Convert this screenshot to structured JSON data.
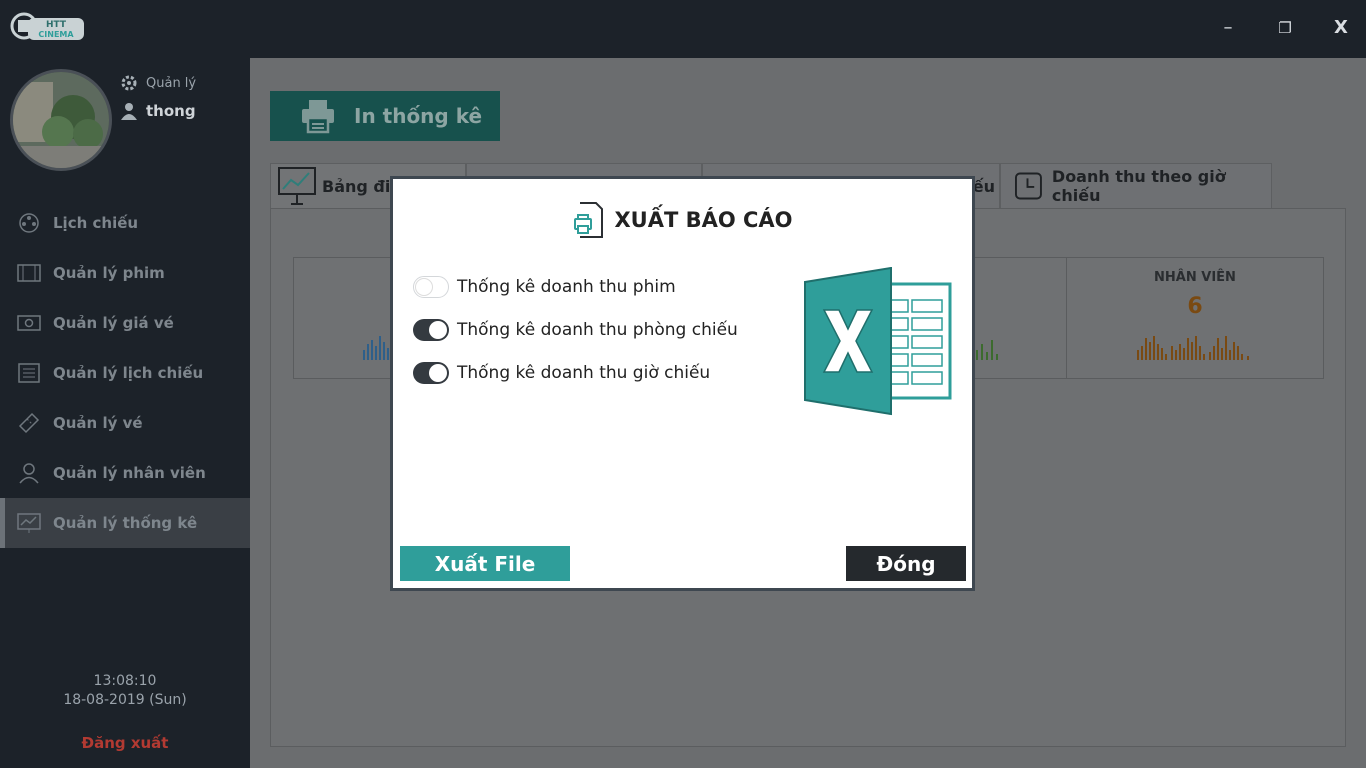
{
  "window": {
    "minimize_label": "–",
    "restore_label": "❐",
    "close_label": "X",
    "logo_top": "HTT",
    "logo_bottom": "CINEMA"
  },
  "user": {
    "role": "Quản lý",
    "name": "thong"
  },
  "sidebar": {
    "items": [
      {
        "label": "Lịch chiếu",
        "icon": "film-reel-icon"
      },
      {
        "label": "Quản lý phim",
        "icon": "film-strip-icon"
      },
      {
        "label": "Quản lý giá vé",
        "icon": "money-icon"
      },
      {
        "label": "Quản lý lịch chiếu",
        "icon": "schedule-list-icon"
      },
      {
        "label": "Quản lý vé",
        "icon": "ticket-icon"
      },
      {
        "label": "Quản lý nhân viên",
        "icon": "user-icon"
      },
      {
        "label": "Quản lý thống kê",
        "icon": "chart-board-icon",
        "active": true
      }
    ],
    "time": "13:08:10",
    "date": "18-08-2019 (Sun)",
    "logout": "Đăng xuất"
  },
  "main": {
    "print_button": "In thống kê",
    "tabs": [
      {
        "label": "Bảng điề",
        "icon": "chart-board-icon",
        "active": true
      },
      {
        "label": "",
        "icon": "film-strip-icon"
      },
      {
        "label": "iếu",
        "icon": "door-icon"
      },
      {
        "label": "Doanh thu theo giờ chiếu",
        "icon": "clock-icon"
      }
    ],
    "cards": [
      {
        "title": "",
        "value": ""
      },
      {
        "title": "",
        "value": ""
      },
      {
        "title": "",
        "value": ""
      },
      {
        "title": "NHÂN VIÊN",
        "value": "6"
      }
    ]
  },
  "modal": {
    "title": "XUẤT BÁO CÁO",
    "options": [
      {
        "label": "Thống kê doanh thu phim",
        "checked": false
      },
      {
        "label": "Thống kê doanh thu phòng chiếu",
        "checked": true
      },
      {
        "label": "Thống kê doanh thu giờ chiếu",
        "checked": true
      }
    ],
    "export_button": "Xuất File",
    "close_button": "Đóng"
  },
  "colors": {
    "sidebar_bg": "#1c2229",
    "accent_teal": "#2f9e9a",
    "dark_button": "#25292d",
    "logout_red": "#b23a32"
  }
}
